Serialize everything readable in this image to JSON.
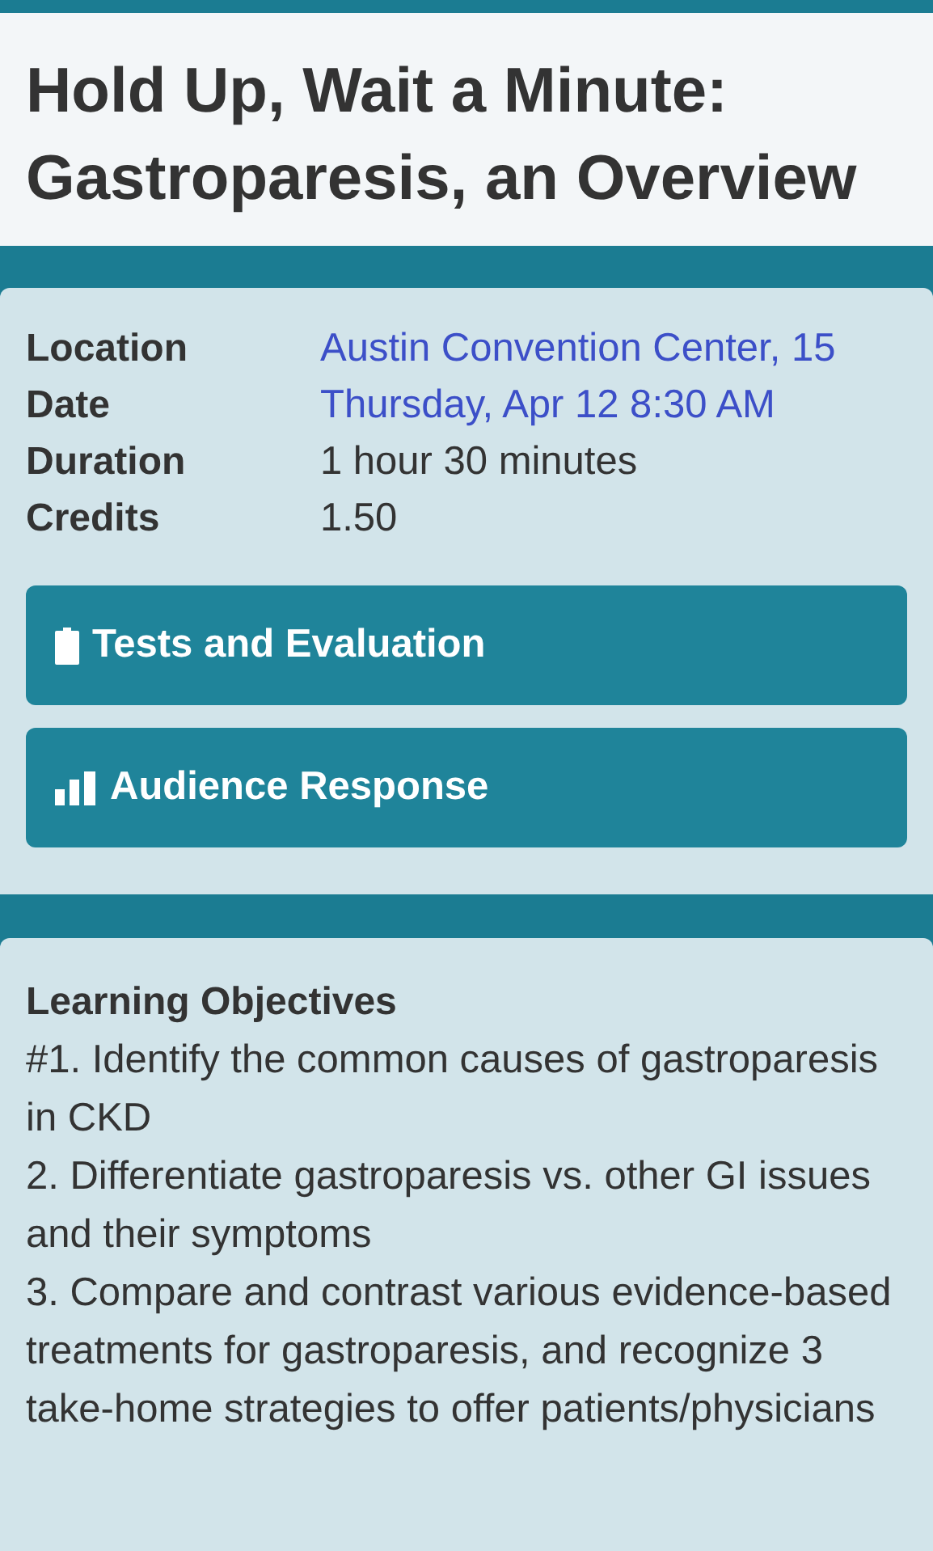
{
  "title": "Hold Up, Wait a Minute: Gastroparesis, an Overview",
  "details": [
    {
      "label": "Location",
      "value": "Austin Convention Center, 15",
      "kind": "link"
    },
    {
      "label": "Date",
      "value": "Thursday, Apr 12 8:30 AM",
      "kind": "link"
    },
    {
      "label": "Duration",
      "value": "1 hour 30 minutes",
      "kind": "text"
    },
    {
      "label": "Credits",
      "value": "1.50",
      "kind": "text"
    }
  ],
  "actions": [
    {
      "label": "Tests and Evaluation",
      "kind": "clipboard"
    },
    {
      "label": "Audience Response",
      "kind": "bars"
    }
  ],
  "objectives": {
    "heading": "Learning Objectives",
    "items": [
      "#1. Identify the common causes of gastroparesis in CKD",
      "2. Differentiate gastroparesis vs. other GI issues and their symptoms",
      "3. Compare and contrast various evidence-based treatments for gastroparesis, and recognize 3 take-home strategies to offer patients/physicians"
    ]
  }
}
